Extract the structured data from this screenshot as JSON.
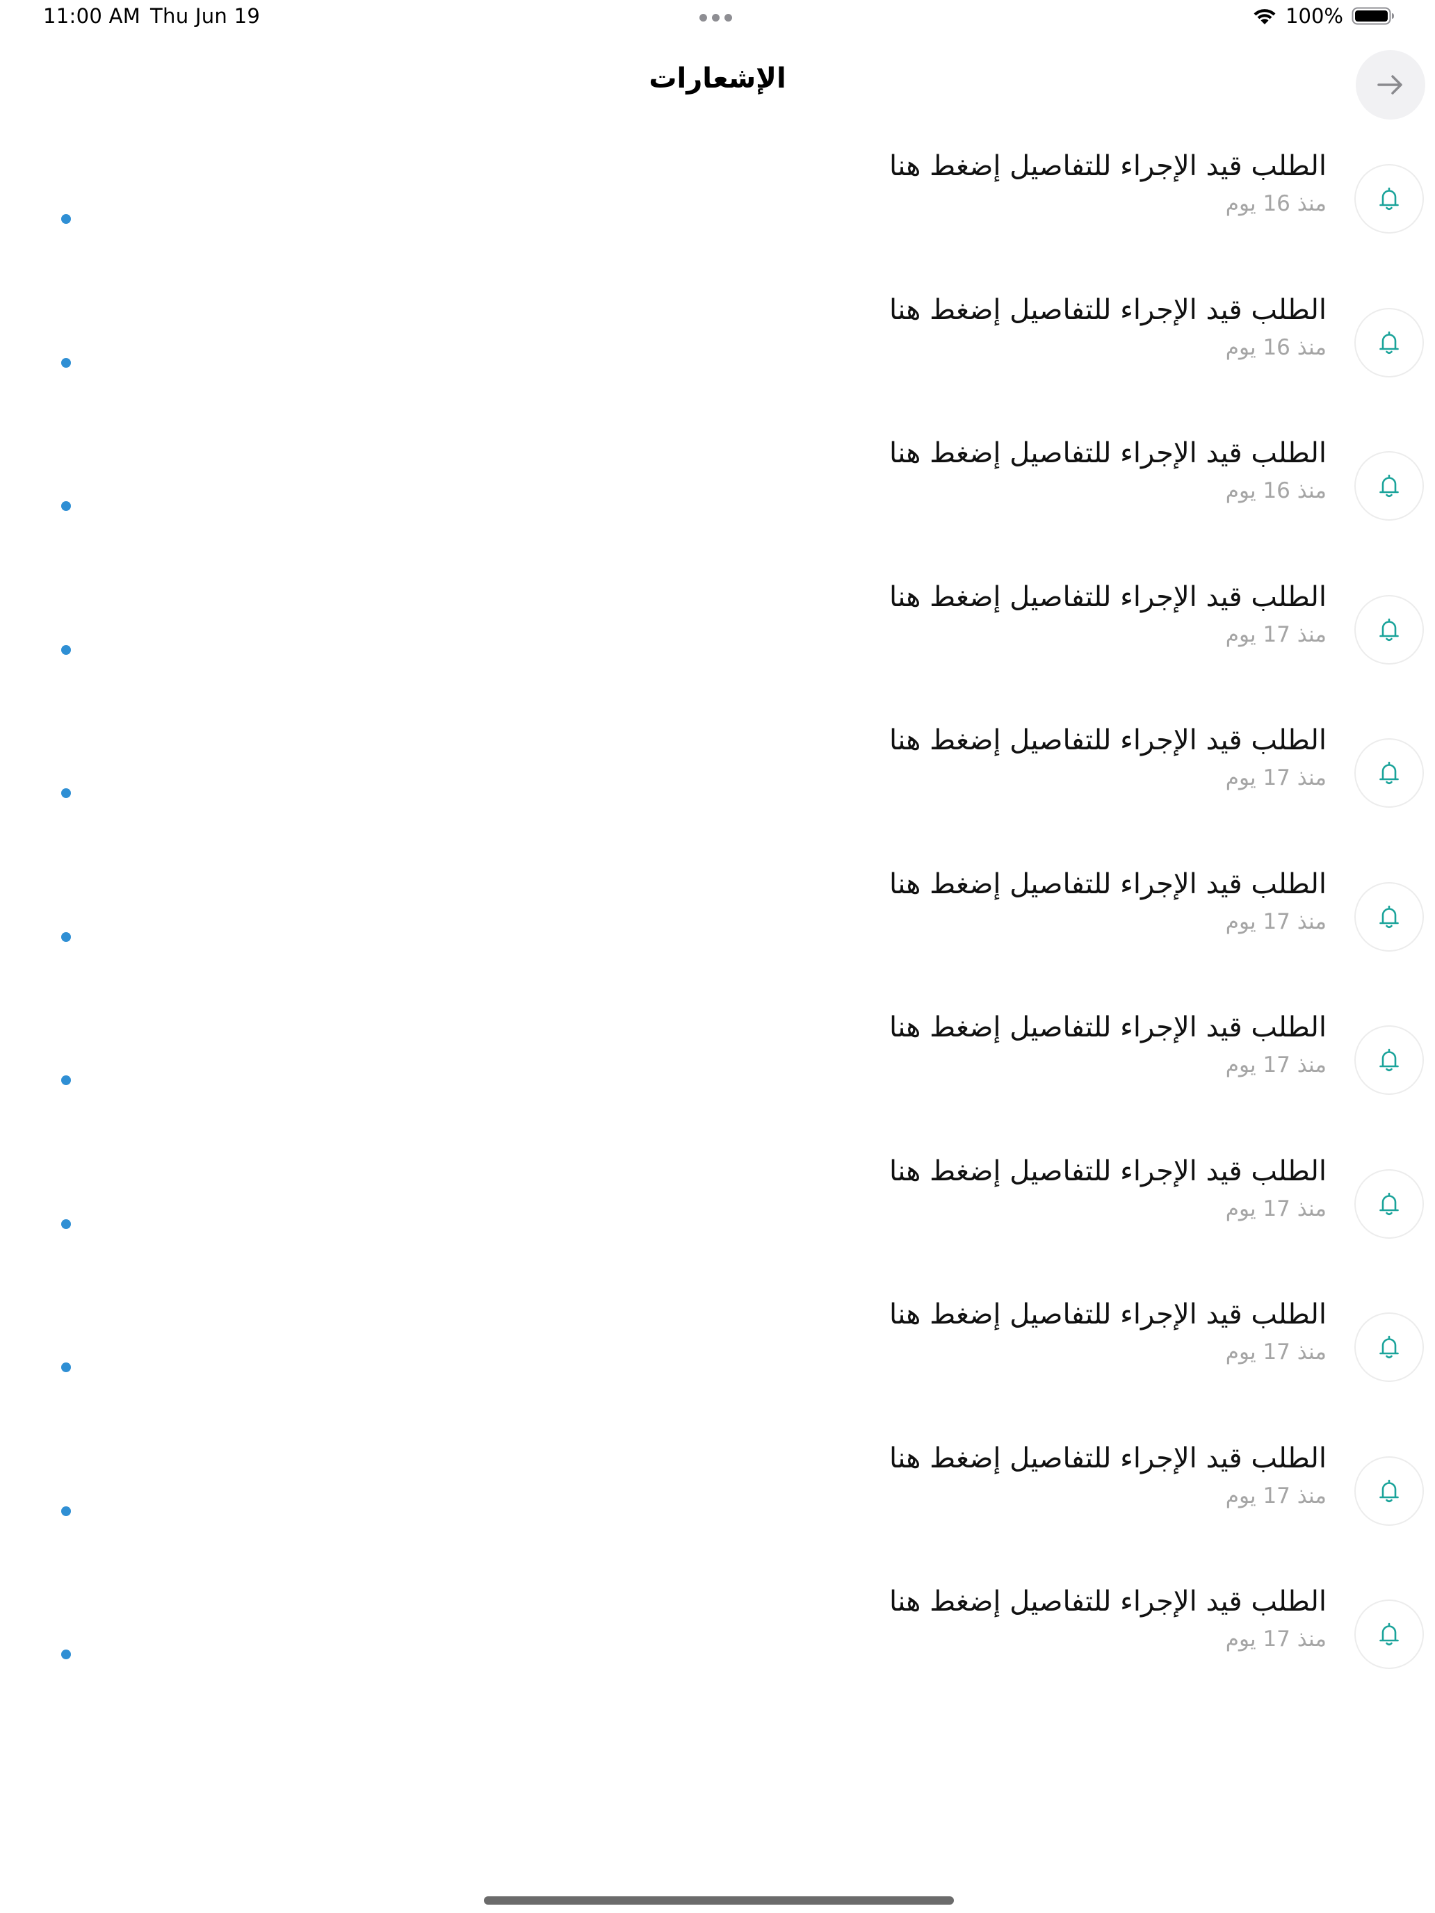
{
  "status_bar": {
    "time": "11:00 AM",
    "date": "Thu Jun 19",
    "battery": "100%",
    "icons": [
      "wifi-icon",
      "battery-icon"
    ]
  },
  "header": {
    "title": "الإشعارات",
    "back_icon": "arrow-right-icon"
  },
  "colors": {
    "bell": "#1aa39a",
    "unread_dot": "#2f8fd4",
    "time_text": "#a5a5a5",
    "back_bg": "#f1f1f3"
  },
  "notifications": [
    {
      "title": "الطلب قيد الإجراء للتفاصيل إضغط هنا",
      "time": "منذ 16 يوم",
      "icon": "bell-icon",
      "unread": true
    },
    {
      "title": "الطلب قيد الإجراء للتفاصيل إضغط هنا",
      "time": "منذ 16 يوم",
      "icon": "bell-icon",
      "unread": true
    },
    {
      "title": "الطلب قيد الإجراء للتفاصيل إضغط هنا",
      "time": "منذ 16 يوم",
      "icon": "bell-icon",
      "unread": true
    },
    {
      "title": "الطلب قيد الإجراء للتفاصيل إضغط هنا",
      "time": "منذ 17 يوم",
      "icon": "bell-icon",
      "unread": true
    },
    {
      "title": "الطلب قيد الإجراء للتفاصيل إضغط هنا",
      "time": "منذ 17 يوم",
      "icon": "bell-icon",
      "unread": true
    },
    {
      "title": "الطلب قيد الإجراء للتفاصيل إضغط هنا",
      "time": "منذ 17 يوم",
      "icon": "bell-icon",
      "unread": true
    },
    {
      "title": "الطلب قيد الإجراء للتفاصيل إضغط هنا",
      "time": "منذ 17 يوم",
      "icon": "bell-icon",
      "unread": true
    },
    {
      "title": "الطلب قيد الإجراء للتفاصيل إضغط هنا",
      "time": "منذ 17 يوم",
      "icon": "bell-icon",
      "unread": true
    },
    {
      "title": "الطلب قيد الإجراء للتفاصيل إضغط هنا",
      "time": "منذ 17 يوم",
      "icon": "bell-icon",
      "unread": true
    },
    {
      "title": "الطلب قيد الإجراء للتفاصيل إضغط هنا",
      "time": "منذ 17 يوم",
      "icon": "bell-icon",
      "unread": true
    },
    {
      "title": "الطلب قيد الإجراء للتفاصيل إضغط هنا",
      "time": "منذ 17 يوم",
      "icon": "bell-icon",
      "unread": true
    }
  ]
}
